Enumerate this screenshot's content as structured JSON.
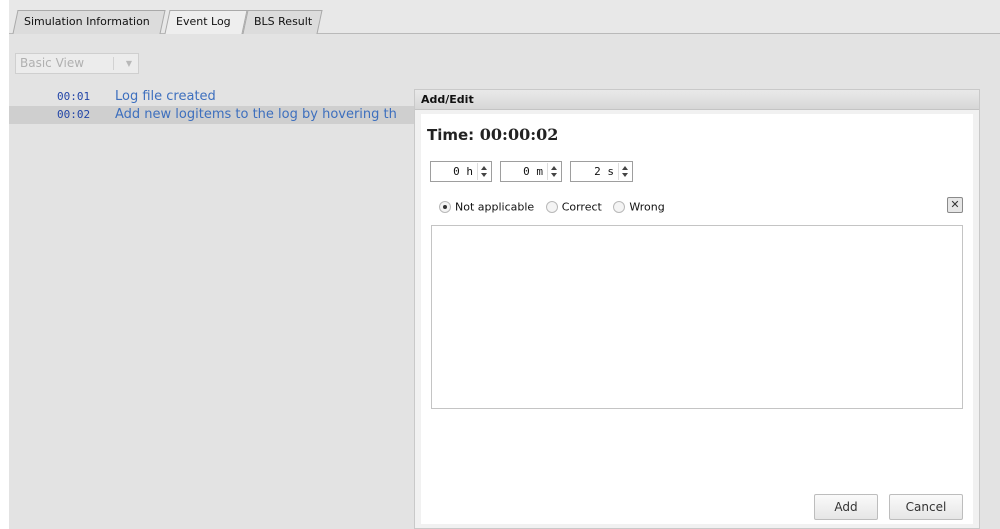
{
  "tabs": [
    {
      "label": "Simulation Information"
    },
    {
      "label": "Event Log"
    },
    {
      "label": "BLS Result"
    }
  ],
  "view_select": {
    "value": "Basic View"
  },
  "log": [
    {
      "time": "00:01",
      "text": "Log file created"
    },
    {
      "time": "00:02",
      "text": "Add new logitems to the log by hovering th"
    }
  ],
  "dialog": {
    "title": "Add/Edit",
    "time_label": "Time:",
    "time_value": "00:00:02",
    "spinners": {
      "hours": "0 h",
      "minutes": "0 m",
      "seconds": "2 s"
    },
    "radios": [
      {
        "label": "Not applicable",
        "checked": true
      },
      {
        "label": "Correct",
        "checked": false
      },
      {
        "label": "Wrong",
        "checked": false
      }
    ],
    "notes_value": "",
    "add_label": "Add",
    "cancel_label": "Cancel"
  },
  "icons": {
    "clear": "close-icon",
    "spinner_up": "caret-up-icon",
    "spinner_down": "caret-down-icon",
    "dropdown": "caret-down-icon"
  },
  "colors": {
    "log_time": "#2346a8",
    "log_text": "#3d6fbe",
    "selected_row": "#cfcfcf"
  }
}
